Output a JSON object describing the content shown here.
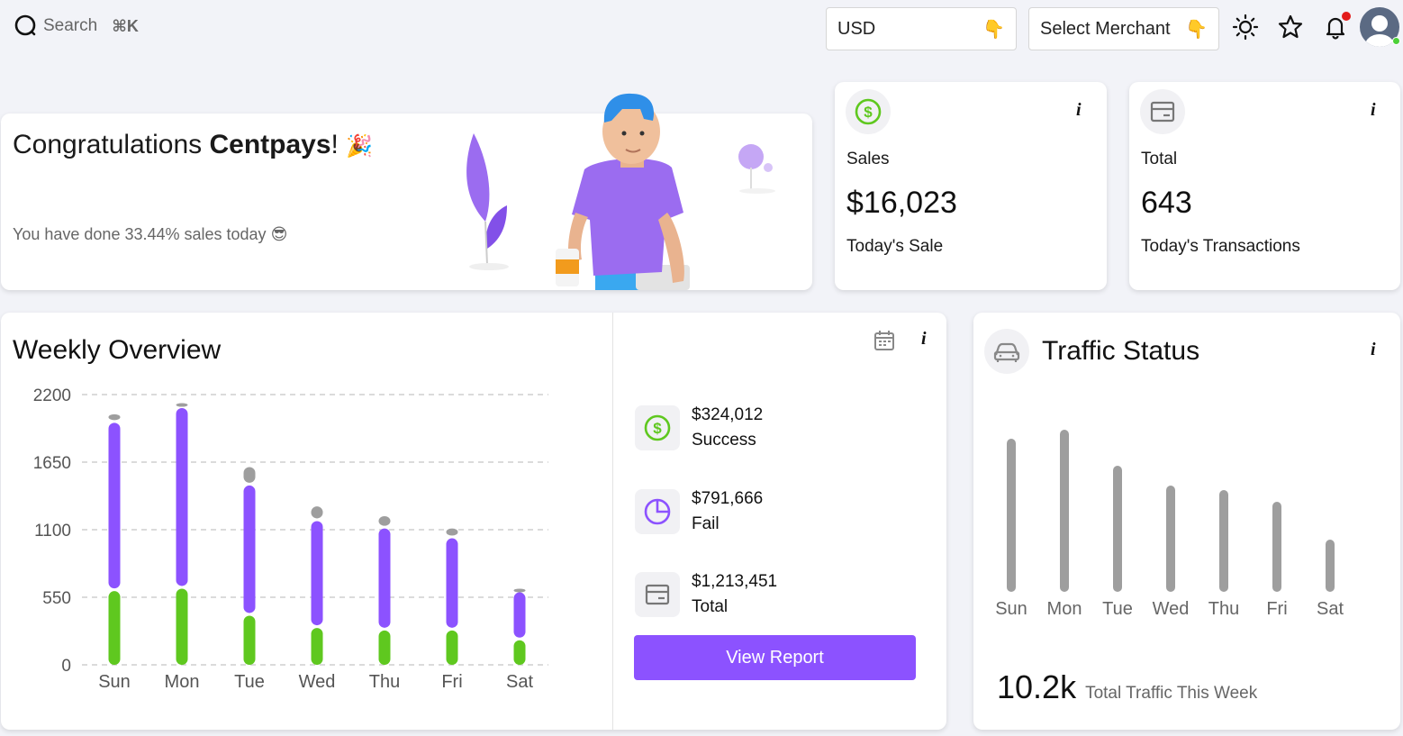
{
  "topbar": {
    "search_label": "Search",
    "shortcut": "⌘K",
    "currency": "USD",
    "merchant_placeholder": "Select Merchant",
    "icons": [
      "search-icon",
      "pointing-hand-icon",
      "sun-icon",
      "star-icon",
      "bell-icon",
      "avatar"
    ],
    "colors": {
      "notification_dot": "#e31b1b",
      "online_status": "#4cd137"
    }
  },
  "congrats": {
    "title_prefix": "Congratulations ",
    "title_name": "Centpays",
    "title_suffix": "!",
    "emoji": "🎉",
    "subtitle": "You have done 33.44% sales today",
    "subtitle_emoji": "😎"
  },
  "sales_card": {
    "label": "Sales",
    "value": "$16,023",
    "sub": "Today's Sale",
    "info": "i",
    "icon": "dollar-circle-icon",
    "icon_color": "#5fc81f"
  },
  "transactions_card": {
    "label": "Total",
    "value": "643",
    "sub": "Today's Transactions",
    "info": "i",
    "icon": "card-icon"
  },
  "weekly": {
    "title": "Weekly Overview",
    "info": "i",
    "legend": [
      {
        "amount": "$324,012",
        "label": "Success",
        "icon": "dollar-circle-icon",
        "color": "#5fc81f"
      },
      {
        "amount": "$791,666",
        "label": "Fail",
        "icon": "pie-chart-icon",
        "color": "#8c52ff"
      },
      {
        "amount": "$1,213,451",
        "label": "Total",
        "icon": "card-icon",
        "color": "#888888"
      }
    ],
    "button": "View Report"
  },
  "traffic": {
    "title": "Traffic Status",
    "info": "i",
    "total": "10.2k",
    "total_caption": "Total Traffic This Week"
  },
  "chart_data": [
    {
      "type": "bar",
      "stacked": true,
      "categories": [
        "Sun",
        "Mon",
        "Tue",
        "Wed",
        "Thu",
        "Fri",
        "Sat"
      ],
      "ylim": [
        0,
        2200
      ],
      "yticks": [
        "2200",
        "1650",
        "1100",
        "550",
        "0"
      ],
      "grid": true,
      "series": [
        {
          "color": "#5fc81f",
          "values": [
            600,
            620,
            400,
            300,
            280,
            280,
            200
          ]
        },
        {
          "color": "#8c52ff",
          "values": [
            1370,
            1470,
            1060,
            870,
            830,
            750,
            390
          ]
        },
        {
          "color": "#9e9e9e",
          "values": [
            70,
            40,
            150,
            120,
            100,
            80,
            30
          ]
        }
      ]
    },
    {
      "type": "bar",
      "categories": [
        "Sun",
        "Mon",
        "Tue",
        "Wed",
        "Thu",
        "Fri",
        "Sat"
      ],
      "grid": false,
      "series": [
        {
          "color": "#9e9e9e",
          "values": [
            1700,
            1800,
            1400,
            1180,
            1130,
            1000,
            580
          ]
        }
      ]
    }
  ]
}
